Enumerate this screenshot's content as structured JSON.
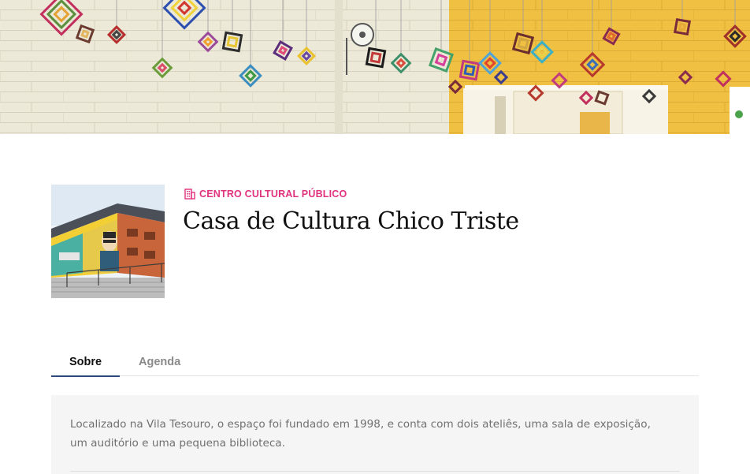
{
  "banner": {
    "image": "cultural-center-hall-with-hanging-yarn-ornaments-photo"
  },
  "venue": {
    "thumbnail": "building-with-mural-photo",
    "category_icon": "building-icon",
    "category": "CENTRO CULTURAL PÚBLICO",
    "name": "Casa de Cultura Chico Triste"
  },
  "tabs": [
    {
      "label": "Sobre",
      "active": true
    },
    {
      "label": "Agenda",
      "active": false
    }
  ],
  "about": {
    "text": "Localizado na Vila Tesouro, o espaço foi fundado em 1998, e conta com dois ateliês, uma sala de exposição, um auditório e uma pequena biblioteca."
  },
  "colors": {
    "accent": "#e0327e",
    "tab_underline": "#2f4a7f",
    "card_bg": "#f5f5f5"
  }
}
